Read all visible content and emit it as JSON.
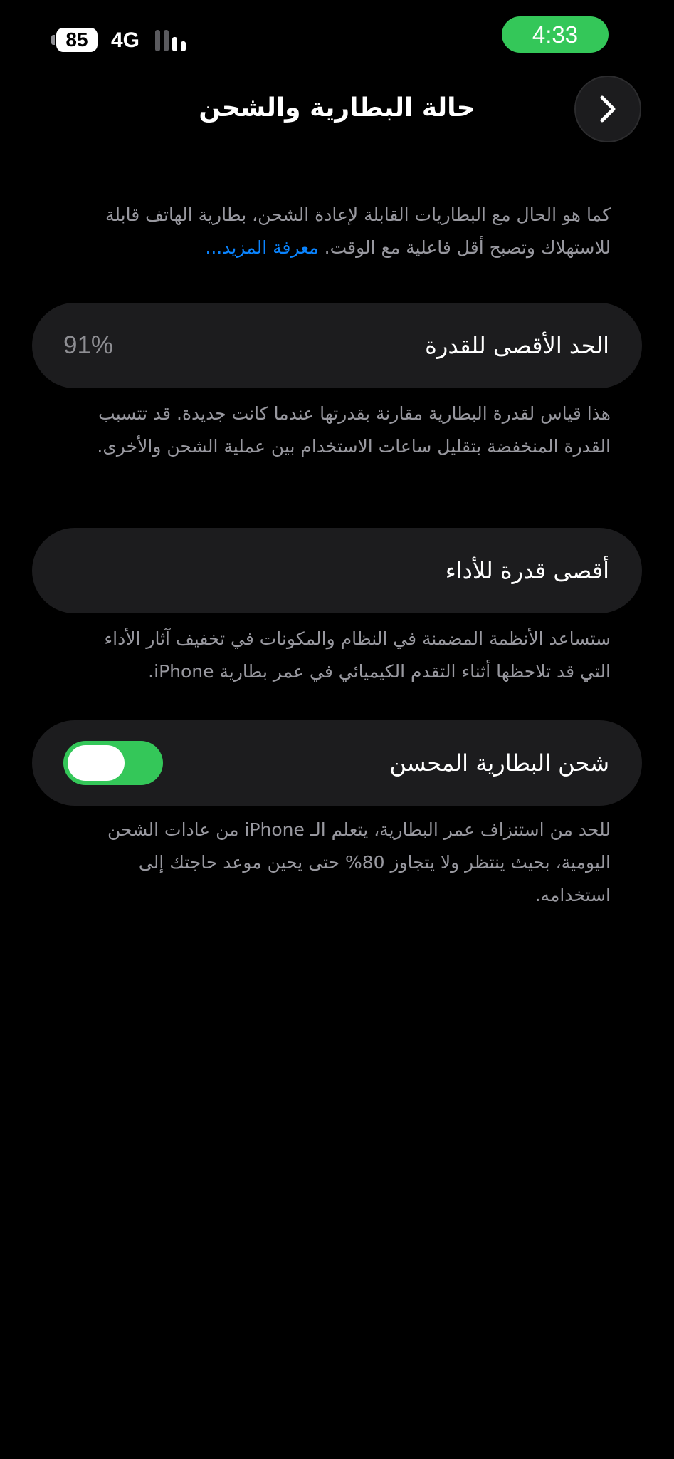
{
  "status_bar": {
    "battery_level": "85",
    "network": "4G",
    "time": "4:33",
    "clock_color": "#34c759"
  },
  "header": {
    "title": "حالة البطارية والشحن",
    "back_icon": "chevron-right-icon"
  },
  "intro": {
    "text": "كما هو الحال مع البطاريات القابلة لإعادة الشحن، بطارية الهاتف قابلة للاستهلاك وتصبح أقل فاعلية مع الوقت.",
    "learn_more": "معرفة المزيد..."
  },
  "max_capacity": {
    "label": "الحد الأقصى للقدرة",
    "value": "91%",
    "description": "هذا قياس لقدرة البطارية مقارنة بقدرتها عندما كانت جديدة. قد تتسبب القدرة المنخفضة بتقليل ساعات الاستخدام بين عملية الشحن والأخرى."
  },
  "peak_performance": {
    "label": "أقصى قدرة للأداء",
    "description": "ستساعد الأنظمة المضمنة في النظام والمكونات في تخفيف آثار الأداء التي قد تلاحظها أثناء التقدم الكيميائي في عمر بطارية iPhone."
  },
  "optimized_charging": {
    "label": "شحن البطارية المحسن",
    "enabled": true,
    "toggle_color": "#34c759",
    "description": "للحد من استنزاف عمر البطارية، يتعلم الـ iPhone من عادات الشحن اليومية، بحيث ينتظر ولا يتجاوز 80% حتى يحين موعد حاجتك إلى استخدامه."
  },
  "colors": {
    "background": "#000000",
    "card": "#1c1c1e",
    "secondary_text": "#98989f",
    "link": "#0a84ff"
  }
}
